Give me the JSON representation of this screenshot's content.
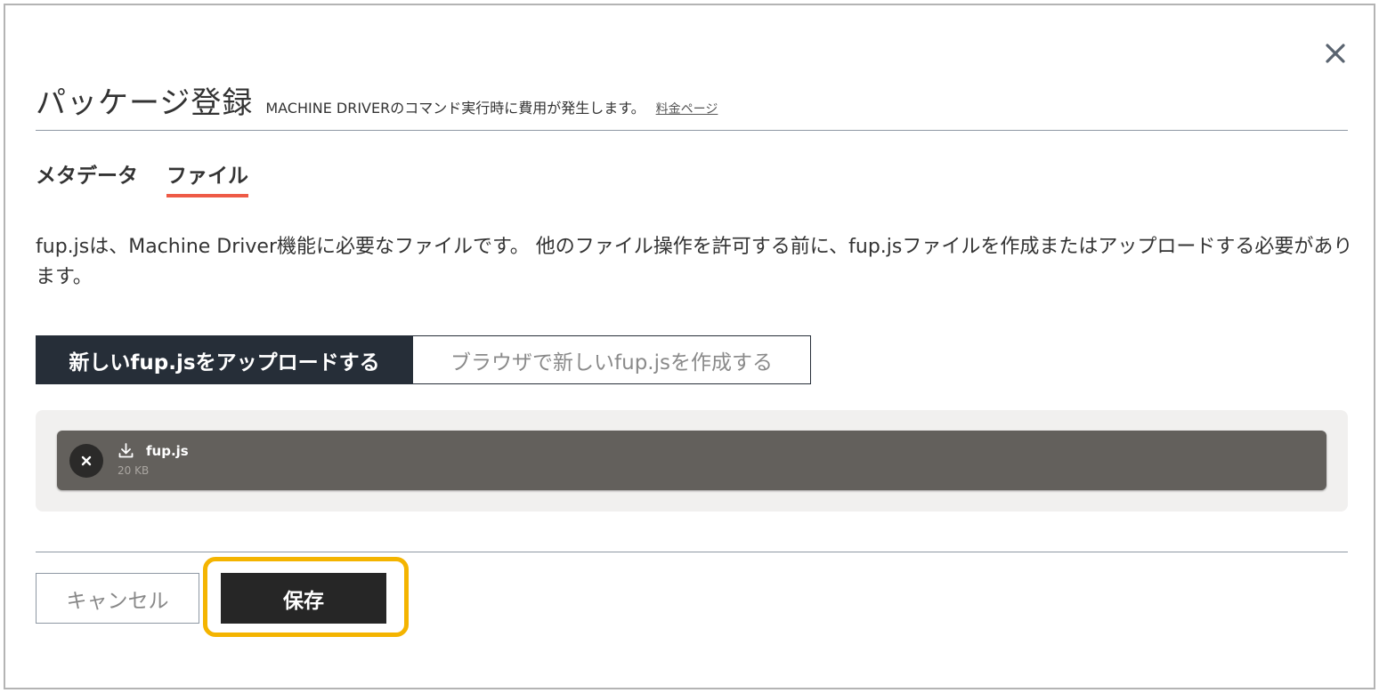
{
  "dialog": {
    "title": "パッケージ登録",
    "subtitle": "MACHINE DRIVERのコマンド実行時に費用が発生します。",
    "pricing_link": "料金ページ"
  },
  "tabs": [
    {
      "label": "メタデータ",
      "active": false
    },
    {
      "label": "ファイル",
      "active": true
    }
  ],
  "description": "fup.jsは、Machine Driver機能に必要なファイルです。 他のファイル操作を許可する前に、fup.jsファイルを作成またはアップロードする必要があります。",
  "mode_toggle": {
    "upload_label": "新しいfup.jsをアップロードする",
    "create_label": "ブラウザで新しいfup.jsを作成する",
    "selected": "upload"
  },
  "file": {
    "name": "fup.js",
    "size": "20 KB"
  },
  "footer": {
    "cancel_label": "キャンセル",
    "save_label": "保存"
  },
  "colors": {
    "tab_underline": "#ee5a46",
    "highlight": "#f4b400",
    "dark": "#262e38"
  }
}
